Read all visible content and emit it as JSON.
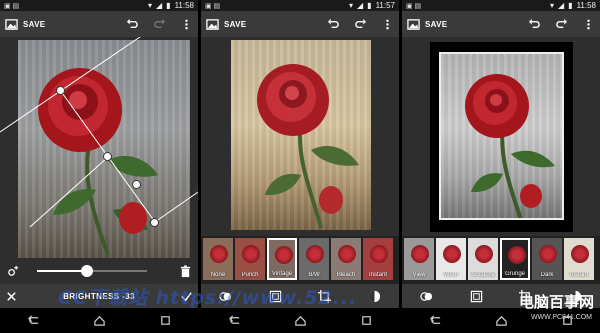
{
  "colors": {
    "accent": "#ffffff",
    "bar": "#3a3a3a",
    "status": "#1a1a1a"
  },
  "panels": [
    {
      "status": {
        "time": "11:58"
      },
      "action": {
        "save_label": "SAVE"
      },
      "adjust": {
        "label": "BRIGHTNESS -33",
        "level": 0.45
      },
      "icons": [
        "image-icon",
        "undo-icon",
        "redo-icon",
        "overflow-menu-icon",
        "add-point-icon",
        "trash-icon",
        "close-icon",
        "check-icon"
      ]
    },
    {
      "status": {
        "time": "11:57"
      },
      "action": {
        "save_label": "SAVE"
      },
      "filters": [
        "None",
        "Punch",
        "Vintage",
        "B/W",
        "Bleach",
        "Instant"
      ],
      "selected_filter": "Vintage",
      "icons": [
        "filters-icon",
        "border-icon",
        "crop-icon",
        "adjust-icon"
      ]
    },
    {
      "status": {
        "time": "11:58"
      },
      "action": {
        "save_label": "SAVE"
      },
      "borders": [
        "View",
        "Worn",
        "Scratchy",
        "Grunge",
        "Dark",
        "Instant"
      ],
      "selected_border": "Grunge",
      "icons": [
        "filters-icon",
        "border-icon",
        "crop-icon",
        "adjust-icon"
      ]
    }
  ],
  "watermark": {
    "text": "CC下载站 https://www.52...",
    "brand_name": "电脑百事网",
    "brand_url": "WWW.PC841.COM"
  }
}
